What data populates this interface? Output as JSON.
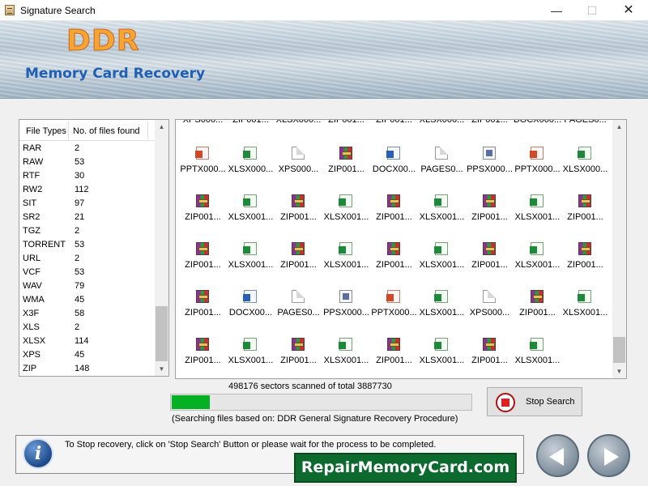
{
  "window": {
    "title": "Signature Search",
    "controls": {
      "minimize": "—",
      "maximize": "☐",
      "close": "✕"
    }
  },
  "banner": {
    "brand": "DDR",
    "subtitle": "Memory Card Recovery"
  },
  "file_types_panel": {
    "headers": {
      "type": "File Types",
      "count": "No. of files found"
    },
    "rows": [
      {
        "type": "RAR",
        "count": "2"
      },
      {
        "type": "RAW",
        "count": "53"
      },
      {
        "type": "RTF",
        "count": "30"
      },
      {
        "type": "RW2",
        "count": "112"
      },
      {
        "type": "SIT",
        "count": "97"
      },
      {
        "type": "SR2",
        "count": "21"
      },
      {
        "type": "TGZ",
        "count": "2"
      },
      {
        "type": "TORRENT",
        "count": "53"
      },
      {
        "type": "URL",
        "count": "2"
      },
      {
        "type": "VCF",
        "count": "53"
      },
      {
        "type": "WAV",
        "count": "79"
      },
      {
        "type": "WMA",
        "count": "45"
      },
      {
        "type": "X3F",
        "count": "58"
      },
      {
        "type": "XLS",
        "count": "2"
      },
      {
        "type": "XLSX",
        "count": "114"
      },
      {
        "type": "XPS",
        "count": "45"
      },
      {
        "type": "ZIP",
        "count": "148"
      }
    ]
  },
  "found_files": {
    "top_partial_row": [
      "XPS000...",
      "ZIP001...",
      "XLSX000...",
      "ZIP001...",
      "ZIP001...",
      "XLSX000...",
      "ZIP001...",
      "DOCX000...",
      "PAGES0..."
    ],
    "rows": [
      [
        {
          "name": "PPTX000...",
          "icon": "pptx-icon"
        },
        {
          "name": "XLSX000...",
          "icon": "xlsx-icon"
        },
        {
          "name": "XPS000...",
          "icon": "blank-file-icon"
        },
        {
          "name": "ZIP001...",
          "icon": "zip-icon"
        },
        {
          "name": "DOCX00...",
          "icon": "docx-icon"
        },
        {
          "name": "PAGES0...",
          "icon": "blank-file-icon"
        },
        {
          "name": "PPSX000...",
          "icon": "ppsx-icon"
        },
        {
          "name": "PPTX000...",
          "icon": "pptx-icon"
        },
        {
          "name": "XLSX000...",
          "icon": "xlsx-icon"
        }
      ],
      [
        {
          "name": "ZIP001...",
          "icon": "zip-icon"
        },
        {
          "name": "XLSX001...",
          "icon": "xlsx-icon"
        },
        {
          "name": "ZIP001...",
          "icon": "zip-icon"
        },
        {
          "name": "XLSX001...",
          "icon": "xlsx-icon"
        },
        {
          "name": "ZIP001...",
          "icon": "zip-icon"
        },
        {
          "name": "XLSX001...",
          "icon": "xlsx-icon"
        },
        {
          "name": "ZIP001...",
          "icon": "zip-icon"
        },
        {
          "name": "XLSX001...",
          "icon": "xlsx-icon"
        },
        {
          "name": "ZIP001...",
          "icon": "zip-icon"
        }
      ],
      [
        {
          "name": "ZIP001...",
          "icon": "zip-icon"
        },
        {
          "name": "XLSX001...",
          "icon": "xlsx-icon"
        },
        {
          "name": "ZIP001...",
          "icon": "zip-icon"
        },
        {
          "name": "XLSX001...",
          "icon": "xlsx-icon"
        },
        {
          "name": "ZIP001...",
          "icon": "zip-icon"
        },
        {
          "name": "XLSX001...",
          "icon": "xlsx-icon"
        },
        {
          "name": "ZIP001...",
          "icon": "zip-icon"
        },
        {
          "name": "XLSX001...",
          "icon": "xlsx-icon"
        },
        {
          "name": "ZIP001...",
          "icon": "zip-icon"
        }
      ],
      [
        {
          "name": "ZIP001...",
          "icon": "zip-icon"
        },
        {
          "name": "DOCX00...",
          "icon": "docx-icon"
        },
        {
          "name": "PAGES0...",
          "icon": "blank-file-icon"
        },
        {
          "name": "PPSX000...",
          "icon": "ppsx-icon"
        },
        {
          "name": "PPTX000...",
          "icon": "pptx-icon"
        },
        {
          "name": "XLSX001...",
          "icon": "xlsx-icon"
        },
        {
          "name": "XPS000...",
          "icon": "blank-file-icon"
        },
        {
          "name": "ZIP001...",
          "icon": "zip-icon"
        },
        {
          "name": "XLSX001...",
          "icon": "xlsx-icon"
        }
      ],
      [
        {
          "name": "ZIP001...",
          "icon": "zip-icon"
        },
        {
          "name": "XLSX001...",
          "icon": "xlsx-icon"
        },
        {
          "name": "ZIP001...",
          "icon": "zip-icon"
        },
        {
          "name": "XLSX001...",
          "icon": "xlsx-icon"
        },
        {
          "name": "ZIP001...",
          "icon": "zip-icon"
        },
        {
          "name": "XLSX001...",
          "icon": "xlsx-icon"
        },
        {
          "name": "ZIP001...",
          "icon": "zip-icon"
        },
        {
          "name": "XLSX001...",
          "icon": "xlsx-icon"
        }
      ]
    ]
  },
  "progress": {
    "status": "498176 sectors scanned of total 3887730",
    "fraction": 0.128,
    "note": "(Searching files based on:  DDR General Signature Recovery Procedure)",
    "fill_color": "#06b025"
  },
  "stop_button": {
    "label": "Stop Search"
  },
  "info": {
    "icon_glyph": "i",
    "text": "To Stop recovery, click on 'Stop Search' Button or please wait for the process to be completed."
  },
  "site_banner": "RepairMemoryCard.com"
}
